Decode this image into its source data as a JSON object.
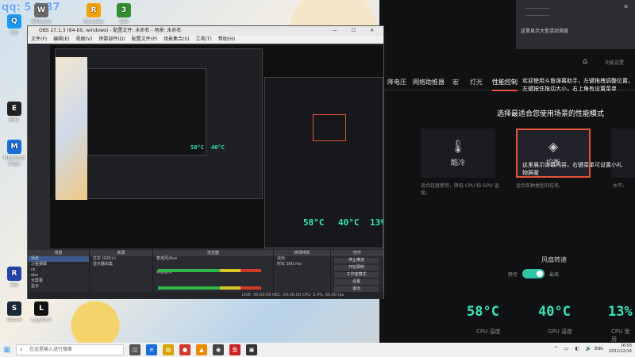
{
  "overlay": {
    "qq": "qq: 5 3 37"
  },
  "desktop_icons": [
    {
      "label": "QQ",
      "color": "#1a9af5",
      "icon": "qq-icon"
    },
    {
      "label": "Webcam",
      "color": "#6a6a6a",
      "icon": "webcam-icon"
    },
    {
      "label": "Rockstar",
      "color": "#f2a100",
      "icon": "rockstar-icon"
    },
    {
      "label": "360",
      "color": "#2d8f2d",
      "icon": "360-icon"
    },
    {
      "label": "EPIC",
      "color": "#222",
      "icon": "epic-icon"
    },
    {
      "label": "Microsoft Edge",
      "color": "#1a6fd6",
      "icon": "edge-icon"
    },
    {
      "label": "RSI",
      "color": "#2244aa",
      "icon": "rsi-icon"
    },
    {
      "label": "Steam",
      "color": "#1b2838",
      "icon": "steam-icon"
    },
    {
      "label": "Logitech",
      "color": "#111",
      "icon": "logitech-icon"
    }
  ],
  "panel": {
    "top_text_1": "...",
    "top_text_2": "这里显示大型活动消息",
    "sub": "功能设置",
    "nav": [
      "降电压",
      "网络助推器",
      "宏",
      "灯光",
      "性能控制"
    ],
    "active_nav": "性能控制",
    "notice": "欢迎使用斗鱼弹幕助手，左键拖拽调整位置，左键按住拖动大小，右上角有设置菜单",
    "notice2": "这里展示弹幕内容，右键菜单可设置小礼物屏蔽",
    "select_title": "选择最适合您使用场景的性能模式",
    "cards": [
      {
        "label": "酷冷",
        "icon": "thermometer-icon",
        "desc": "适合轻度使用，降低 CPU 和 GPU 温度。"
      },
      {
        "label": "均衡",
        "icon": "balance-icon",
        "desc": "适合各种类型的任务。"
      },
      {
        "label": "",
        "icon": "",
        "desc": "水平。"
      }
    ],
    "fan_title": "风扇转速",
    "fan_off": "静音",
    "fan_on": "最高",
    "temps": [
      {
        "value": "58°C",
        "label": "CPU 温度"
      },
      {
        "value": "40°C",
        "label": "GPU 温度"
      },
      {
        "value": "13%",
        "label": "CPU 使用"
      }
    ]
  },
  "obs": {
    "title": "OBS 27.1.3 (64-bit, windows) - 配置文件: 未命名 - 场景: 未命名",
    "menu": [
      "文件(F)",
      "编辑(E)",
      "视图(V)",
      "停靠部件(D)",
      "配置文件(P)",
      "场景集合(S)",
      "工具(T)",
      "帮助(H)"
    ],
    "docks": {
      "scenes": "场景",
      "sources": "来源",
      "mixer": "混音器",
      "transitions": "转场特效",
      "controls": "控件"
    },
    "scene_items": [
      "场景",
      "斗鱼弹幕",
      "cs",
      "obs",
      "大屏幕",
      "显示"
    ],
    "source_items": [
      "文本 (GDI+)",
      "显示器采集"
    ],
    "mixer_items": [
      "麦克风/Aux",
      "桌面音频"
    ],
    "transition": "淡出",
    "duration_label": "时长",
    "duration": "300 ms",
    "controls": [
      "停止推流",
      "开始录制",
      "工作室模式",
      "设置",
      "退出"
    ],
    "status": "LIVE: 00:00:00   REC: 00:00:00   CPU: 3.4%, 60.00 fps"
  },
  "taskbar": {
    "search": "在这里输入进行搜索",
    "time": "16:03",
    "date": "2021/12/14",
    "lang": "ENG"
  }
}
